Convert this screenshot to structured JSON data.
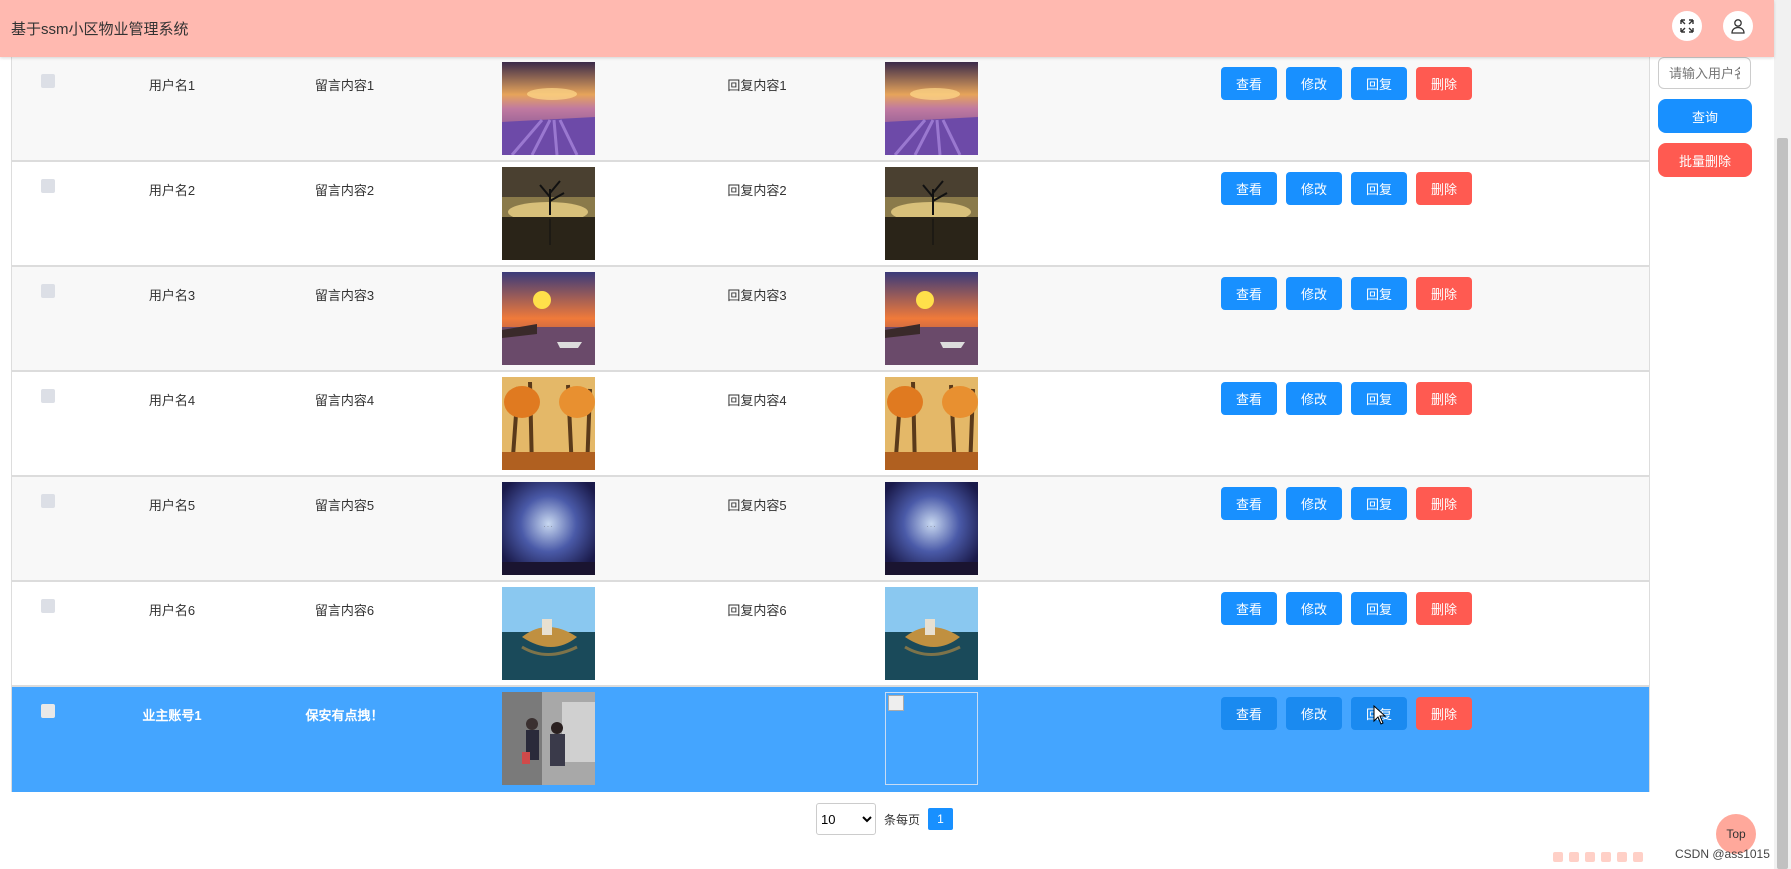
{
  "header": {
    "title": "基于ssm小区物业管理系统"
  },
  "icons": {
    "fullscreen": "fullscreen-icon",
    "user": "user-icon"
  },
  "colors": {
    "header_bg": "#ffb9b0",
    "primary": "#1890ff",
    "danger": "#ff5a51",
    "selected_row": "#44a5ff"
  },
  "table": {
    "actions": {
      "view": "查看",
      "edit": "修改",
      "reply": "回复",
      "delete": "删除"
    },
    "rows": [
      {
        "user": "用户名1",
        "message": "留言内容1",
        "reply": "回复内容1",
        "image": "lavender-field",
        "reply_image": "lavender-field"
      },
      {
        "user": "用户名2",
        "message": "留言内容2",
        "reply": "回复内容2",
        "image": "lone-tree-lake",
        "reply_image": "lone-tree-lake"
      },
      {
        "user": "用户名3",
        "message": "留言内容3",
        "reply": "回复内容3",
        "image": "sunset-harbor",
        "reply_image": "sunset-harbor"
      },
      {
        "user": "用户名4",
        "message": "留言内容4",
        "reply": "回复内容4",
        "image": "autumn-forest",
        "reply_image": "autumn-forest"
      },
      {
        "user": "用户名5",
        "message": "留言内容5",
        "reply": "回复内容5",
        "image": "night-sky",
        "reply_image": "night-sky"
      },
      {
        "user": "用户名6",
        "message": "留言内容6",
        "reply": "回复内容6",
        "image": "lake-village",
        "reply_image": "lake-village"
      },
      {
        "user": "业主账号1",
        "message": "保安有点拽！",
        "reply": "",
        "image": "people-photo",
        "reply_image": "broken-image"
      }
    ]
  },
  "search": {
    "placeholder": "请输入用户名",
    "query_label": "查询",
    "batch_delete_label": "批量删除"
  },
  "pagination": {
    "page_size": "10",
    "page_size_options": [
      "10"
    ],
    "per_page_label": "条每页",
    "current_page": "1"
  },
  "top_label": "Top",
  "watermark": "CSDN @ass1015"
}
